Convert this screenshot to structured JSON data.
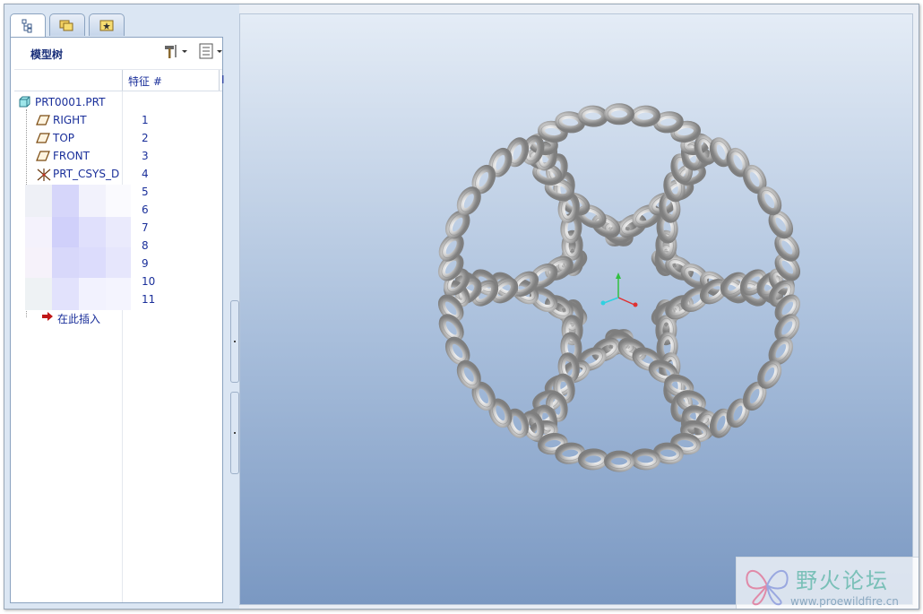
{
  "panel": {
    "title": "模型树",
    "col_feature": "特征 #",
    "col_extra": "I"
  },
  "tree": {
    "root": "PRT0001.PRT",
    "items": [
      {
        "label": "RIGHT",
        "num": "1",
        "icon": "datum-plane-icon"
      },
      {
        "label": "TOP",
        "num": "2",
        "icon": "datum-plane-icon"
      },
      {
        "label": "FRONT",
        "num": "3",
        "icon": "datum-plane-icon"
      },
      {
        "label": "PRT_CSYS_D",
        "num": "4",
        "icon": "coordinate-system-icon"
      }
    ],
    "hidden_nums": [
      "5",
      "6",
      "7",
      "8",
      "9",
      "10",
      "11"
    ],
    "insert_here": "在此插入"
  },
  "watermark": {
    "name": "野火论坛",
    "url": "www.proewildfire.cn"
  },
  "colors": {
    "text_blue": "#1a2f9a",
    "coil": "#c8c8c8"
  }
}
